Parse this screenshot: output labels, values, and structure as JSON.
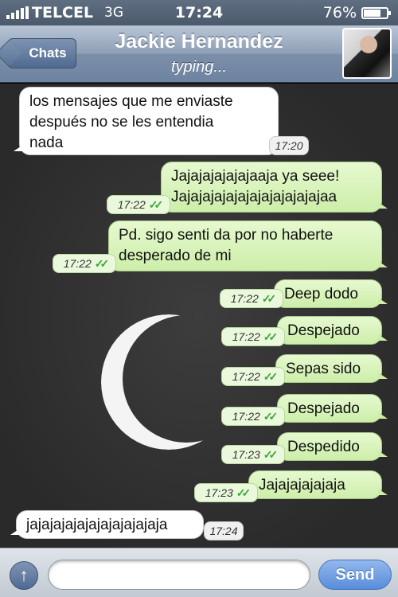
{
  "status_bar": {
    "carrier": "TELCEL",
    "network": "3G",
    "time": "17:24",
    "battery_percent": "76%",
    "battery_level": 0.76,
    "signal_icon": "signal-bars-icon",
    "battery_icon": "battery-icon"
  },
  "header": {
    "back_label": "Chats",
    "contact_name": "Jackie Hernandez",
    "status": "typing..."
  },
  "messages": [
    {
      "direction": "in",
      "text_lines": [
        "los mensajes que me enviaste",
        "después no se les entendia",
        "nada"
      ],
      "time": "17:20"
    },
    {
      "direction": "out",
      "text_lines": [
        "Jajajajajajajaaja ya seee!",
        "Jajajajajajajajajajajajajaa"
      ],
      "time": "17:22",
      "read": true
    },
    {
      "direction": "out",
      "text_lines": [
        "Pd. sigo senti da por no haberte",
        "desperado de mi"
      ],
      "time": "17:22",
      "read": true
    },
    {
      "direction": "out",
      "text_lines": [
        "Deep dodo"
      ],
      "time": "17:22",
      "read": true
    },
    {
      "direction": "out",
      "text_lines": [
        "Despejado"
      ],
      "time": "17:22",
      "read": true
    },
    {
      "direction": "out",
      "text_lines": [
        "Sepas sido"
      ],
      "time": "17:22",
      "read": true
    },
    {
      "direction": "out",
      "text_lines": [
        "Despejado"
      ],
      "time": "17:22",
      "read": true
    },
    {
      "direction": "out",
      "text_lines": [
        "Despedido"
      ],
      "time": "17:23",
      "read": true
    },
    {
      "direction": "out",
      "text_lines": [
        "Jajajajajajaja"
      ],
      "time": "17:23",
      "read": true
    },
    {
      "direction": "in",
      "text_lines": [
        "jajajajajajajajajajajaja"
      ],
      "time": "17:24"
    }
  ],
  "input_bar": {
    "attach_icon": "arrow-up-icon",
    "message_value": "",
    "send_label": "Send"
  },
  "colors": {
    "incoming_bubble": "#ffffff",
    "outgoing_bubble": "#dcf8c6",
    "read_check": "#3aa83a",
    "send_button": "#4d86dc"
  }
}
